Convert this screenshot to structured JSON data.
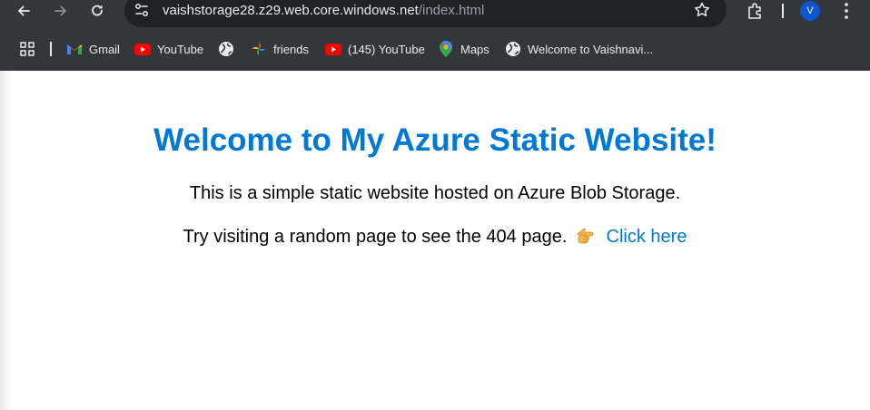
{
  "browser": {
    "url_host": "vaishstorage28.z29.web.core.windows.net",
    "url_path": "/index.html",
    "profile_initial": "V",
    "accent_color": "#0b57d0",
    "icons": [
      "back-icon",
      "forward-icon",
      "reload-icon",
      "site-info-icon",
      "star-icon",
      "extensions-icon",
      "menu-icon",
      "apps-icon"
    ]
  },
  "bookmarks": [
    {
      "label": "Gmail",
      "icon": "gmail-icon"
    },
    {
      "label": "YouTube",
      "icon": "youtube-icon"
    },
    {
      "label": "",
      "icon": "globe-icon"
    },
    {
      "label": "friends",
      "icon": "photos-icon"
    },
    {
      "label": "(145) YouTube",
      "icon": "youtube-icon"
    },
    {
      "label": "Maps",
      "icon": "maps-icon"
    },
    {
      "label": "Welcome to Vaishnavi...",
      "icon": "globe-icon"
    }
  ],
  "page": {
    "heading": "Welcome to My Azure Static Website!",
    "intro": "This is a simple static website hosted on Azure Blob Storage.",
    "try_text": "Try visiting a random page to see the 404 page.",
    "link_text": "Click here",
    "heading_color": "#0078d4",
    "link_color": "#0078d4"
  }
}
